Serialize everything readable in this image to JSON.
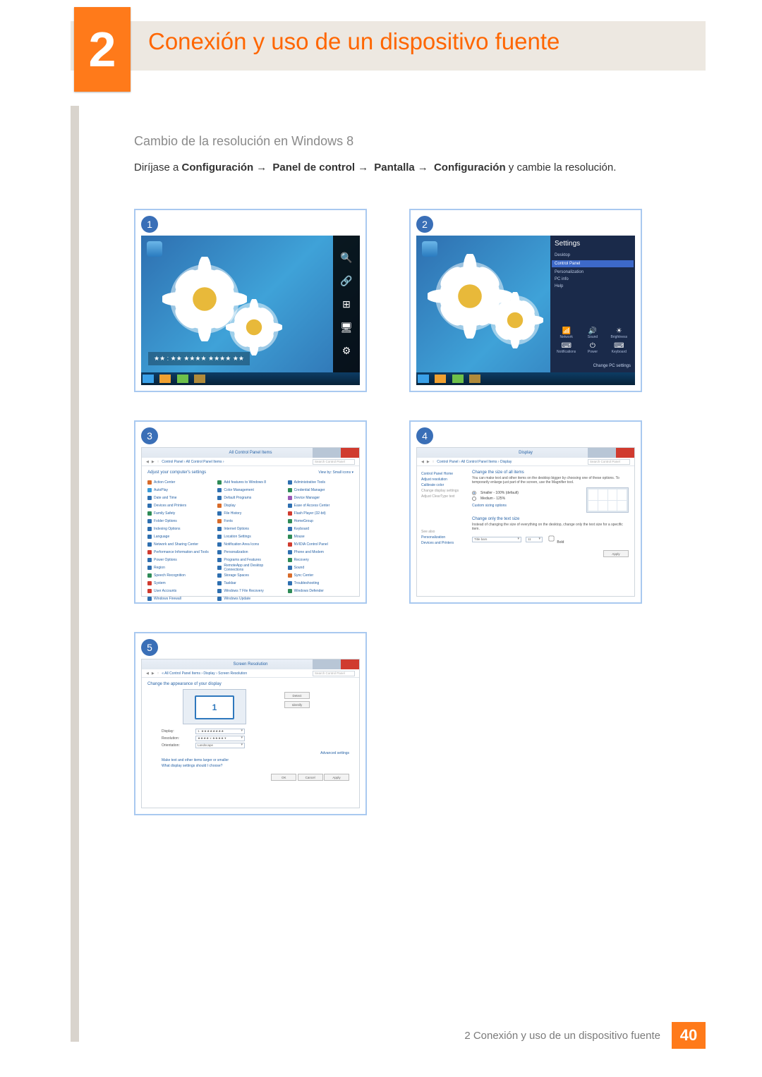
{
  "chapter": {
    "number": "2",
    "title": "Conexión y uso de un dispositivo fuente"
  },
  "subheading": "Cambio de la resolución en Windows 8",
  "instruction": {
    "lead": "Diríjase a ",
    "path": [
      "Configuración",
      "Panel de control",
      "Pantalla",
      "Configuración"
    ],
    "tail": " y cambie la resolución."
  },
  "steps": {
    "s1": {
      "num": "1",
      "charms": [
        "Search",
        "Share",
        "Start",
        "Devices",
        "Settings"
      ],
      "time": "★★ : ★★    ★★★★\n             ★★★★ ★★"
    },
    "s2": {
      "num": "2",
      "panel_title": "Settings",
      "panel_items": [
        {
          "label": "Desktop",
          "sel": false
        },
        {
          "label": "Control Panel",
          "sel": true
        },
        {
          "label": "Personalization",
          "sel": false
        },
        {
          "label": "PC info",
          "sel": false
        },
        {
          "label": "Help",
          "sel": false
        }
      ],
      "bottom_icons": [
        {
          "glyph": "📶",
          "label": "Network"
        },
        {
          "glyph": "🔊",
          "label": "Sound"
        },
        {
          "glyph": "☀",
          "label": "Brightness"
        },
        {
          "glyph": "⌨",
          "label": "Notifications"
        },
        {
          "glyph": "⏻",
          "label": "Power"
        },
        {
          "glyph": "⌨",
          "label": "Keyboard"
        }
      ],
      "change_pc": "Change PC settings"
    },
    "s3": {
      "num": "3",
      "win_title": "All Control Panel Items",
      "breadcrumb": "Control Panel  ›  All Control Panel Items  ›",
      "search_ph": "Search Control Panel",
      "adjust": "Adjust your computer's settings",
      "view_by": "View by:  Small icons ▾",
      "items": [
        {
          "ic": "#d86b2a",
          "t": "Action Center"
        },
        {
          "ic": "#2e8b57",
          "t": "Add features to Windows 8"
        },
        {
          "ic": "#2e6fb0",
          "t": "Administrative Tools"
        },
        {
          "ic": "#3a9bd8",
          "t": "AutoPlay"
        },
        {
          "ic": "#2e6fb0",
          "t": "Color Management"
        },
        {
          "ic": "#2e8b57",
          "t": "Credential Manager"
        },
        {
          "ic": "#2e6fb0",
          "t": "Date and Time"
        },
        {
          "ic": "#2e6fb0",
          "t": "Default Programs"
        },
        {
          "ic": "#9b59b6",
          "t": "Device Manager"
        },
        {
          "ic": "#2e6fb0",
          "t": "Devices and Printers"
        },
        {
          "ic": "#d86b2a",
          "t": "Display"
        },
        {
          "ic": "#2e6fb0",
          "t": "Ease of Access Center"
        },
        {
          "ic": "#2e8b57",
          "t": "Family Safety"
        },
        {
          "ic": "#2e6fb0",
          "t": "File History"
        },
        {
          "ic": "#d03b2f",
          "t": "Flash Player (32-bit)"
        },
        {
          "ic": "#2e6fb0",
          "t": "Folder Options"
        },
        {
          "ic": "#d86b2a",
          "t": "Fonts"
        },
        {
          "ic": "#2e8b57",
          "t": "HomeGroup"
        },
        {
          "ic": "#2e6fb0",
          "t": "Indexing Options"
        },
        {
          "ic": "#2e6fb0",
          "t": "Internet Options"
        },
        {
          "ic": "#2e6fb0",
          "t": "Keyboard"
        },
        {
          "ic": "#2e6fb0",
          "t": "Language"
        },
        {
          "ic": "#2e6fb0",
          "t": "Location Settings"
        },
        {
          "ic": "#2e8b57",
          "t": "Mouse"
        },
        {
          "ic": "#2e6fb0",
          "t": "Network and Sharing Center"
        },
        {
          "ic": "#2e6fb0",
          "t": "Notification Area Icons"
        },
        {
          "ic": "#d03b2f",
          "t": "NVIDIA Control Panel"
        },
        {
          "ic": "#d03b2f",
          "t": "Performance Information and Tools"
        },
        {
          "ic": "#2e6fb0",
          "t": "Personalization"
        },
        {
          "ic": "#2e6fb0",
          "t": "Phone and Modem"
        },
        {
          "ic": "#2e6fb0",
          "t": "Power Options"
        },
        {
          "ic": "#2e6fb0",
          "t": "Programs and Features"
        },
        {
          "ic": "#2e8b57",
          "t": "Recovery"
        },
        {
          "ic": "#2e6fb0",
          "t": "Region"
        },
        {
          "ic": "#2e6fb0",
          "t": "RemoteApp and Desktop Connections"
        },
        {
          "ic": "#2e6fb0",
          "t": "Sound"
        },
        {
          "ic": "#2e8b57",
          "t": "Speech Recognition"
        },
        {
          "ic": "#2e6fb0",
          "t": "Storage Spaces"
        },
        {
          "ic": "#d86b2a",
          "t": "Sync Center"
        },
        {
          "ic": "#d03b2f",
          "t": "System"
        },
        {
          "ic": "#2e6fb0",
          "t": "Taskbar"
        },
        {
          "ic": "#2e6fb0",
          "t": "Troubleshooting"
        },
        {
          "ic": "#d03b2f",
          "t": "User Accounts"
        },
        {
          "ic": "#2e6fb0",
          "t": "Windows 7 File Recovery"
        },
        {
          "ic": "#2e8b57",
          "t": "Windows Defender"
        },
        {
          "ic": "#2e6fb0",
          "t": "Windows Firewall"
        },
        {
          "ic": "#2e6fb0",
          "t": "Windows Update"
        }
      ]
    },
    "s4": {
      "num": "4",
      "win_title": "Display",
      "breadcrumb": "Control Panel  ›  All Control Panel Items  ›  Display",
      "search_ph": "Search Control Panel",
      "side": [
        {
          "t": "Control Panel Home",
          "dim": false
        },
        {
          "t": "Adjust resolution",
          "dim": false
        },
        {
          "t": "Calibrate color",
          "dim": false
        },
        {
          "t": "Change display settings",
          "dim": true
        },
        {
          "t": "Adjust ClearType text",
          "dim": true
        }
      ],
      "see_also": [
        "See also",
        "Personalization",
        "Devices and Printers"
      ],
      "sec1_title": "Change the size of all items",
      "sec1_desc": "You can make text and other items on the desktop bigger by choosing one of these options. To temporarily enlarge just part of the screen, use the Magnifier tool.",
      "opt1": "Smaller - 100% (default)",
      "opt2": "Medium - 125%",
      "custom": "Custom sizing options",
      "sec2_title": "Change only the text size",
      "sec2_desc": "Instead of changing the size of everything on the desktop, change only the text size for a specific item.",
      "sec2_label": "Title bars",
      "sec2_size": "11",
      "sec2_bold": "Bold",
      "apply": "Apply"
    },
    "s5": {
      "num": "5",
      "win_title": "Screen Resolution",
      "breadcrumb": "« All Control Panel Items  ›  Display  ›  Screen Resolution",
      "search_ph": "Search Control Panel",
      "title": "Change the appearance of your display",
      "detect": "Detect",
      "identify": "Identify",
      "monitor_num": "1",
      "fields": [
        {
          "lbl": "Display:",
          "val": "1. ★★★★★★★★"
        },
        {
          "lbl": "Resolution:",
          "val": "★★★★ x ★★★★ ▾"
        },
        {
          "lbl": "Orientation:",
          "val": "Landscape"
        }
      ],
      "adv": "Advanced settings",
      "note1": "Make text and other items larger or smaller",
      "note2": "What display settings should I choose?",
      "ok": "OK",
      "cancel": "Cancel",
      "apply": "Apply"
    }
  },
  "footer": {
    "text": "2 Conexión y uso de un dispositivo fuente",
    "page": "40"
  }
}
